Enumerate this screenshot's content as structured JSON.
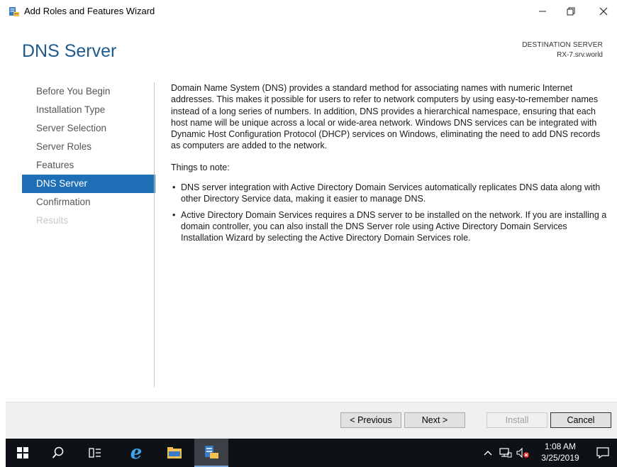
{
  "window": {
    "title": "Add Roles and Features Wizard",
    "controls": {
      "minimize": "—",
      "maximize": "🗗",
      "close": "✕"
    }
  },
  "header": {
    "page_title": "DNS Server",
    "destination_label": "DESTINATION SERVER",
    "destination_value": "RX-7.srv.world"
  },
  "nav": {
    "items": [
      {
        "label": "Before You Begin",
        "state": "normal"
      },
      {
        "label": "Installation Type",
        "state": "normal"
      },
      {
        "label": "Server Selection",
        "state": "normal"
      },
      {
        "label": "Server Roles",
        "state": "normal"
      },
      {
        "label": "Features",
        "state": "normal"
      },
      {
        "label": "DNS Server",
        "state": "active"
      },
      {
        "label": "Confirmation",
        "state": "normal"
      },
      {
        "label": "Results",
        "state": "disabled"
      }
    ]
  },
  "content": {
    "description": "Domain Name System (DNS) provides a standard method for associating names with numeric Internet addresses. This makes it possible for users to refer to network computers by using easy-to-remember names instead of a long series of numbers. In addition, DNS provides a hierarchical namespace, ensuring that each host name will be unique across a local or wide-area network. Windows DNS services can be integrated with Dynamic Host Configuration Protocol (DHCP) services on Windows, eliminating the need to add DNS records as computers are added to the network.",
    "notes_heading": "Things to note:",
    "notes": [
      "DNS server integration with Active Directory Domain Services automatically replicates DNS data along with other Directory Service data, making it easier to manage DNS.",
      "Active Directory Domain Services requires a DNS server to be installed on the network. If you are installing a domain controller, you can also install the DNS Server role using Active Directory Domain Services Installation Wizard by selecting the Active Directory Domain Services role."
    ]
  },
  "footer": {
    "previous_label": "< Previous",
    "next_label": "Next >",
    "install_label": "Install",
    "cancel_label": "Cancel"
  },
  "taskbar": {
    "items": [
      "start-icon",
      "search-icon",
      "task-view-icon",
      "internet-explorer-icon",
      "file-explorer-icon",
      "server-manager-icon"
    ],
    "tray_icons": [
      "chevron-up-icon",
      "network-icon",
      "volume-muted-icon"
    ],
    "time": "1:08 AM",
    "date": "3/25/2019",
    "notification_icon": "action-center-icon"
  },
  "colors": {
    "accent": "#1e6fb5",
    "title": "#1e5a8c",
    "taskbar": "#0e1116"
  }
}
